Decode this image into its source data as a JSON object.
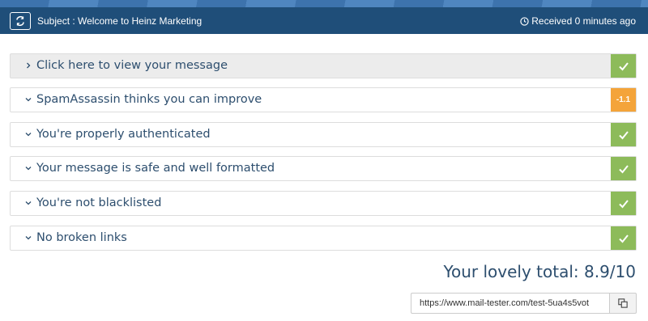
{
  "header": {
    "subject": "Subject : Welcome to Heinz Marketing",
    "received": "Received 0 minutes ago",
    "refresh_icon": "refresh-icon",
    "clock_icon": "clock-icon",
    "background_color": "#1f4e79"
  },
  "checks": [
    {
      "label": "Click here to view your message",
      "expanded": false,
      "status": "ok",
      "badge": "✓"
    },
    {
      "label": "SpamAssassin thinks you can improve",
      "expanded": true,
      "status": "warn",
      "badge": "-1.1"
    },
    {
      "label": "You're properly authenticated",
      "expanded": true,
      "status": "ok",
      "badge": "✓"
    },
    {
      "label": "Your message is safe and well formatted",
      "expanded": true,
      "status": "ok",
      "badge": "✓"
    },
    {
      "label": "You're not blacklisted",
      "expanded": true,
      "status": "ok",
      "badge": "✓"
    },
    {
      "label": "No broken links",
      "expanded": true,
      "status": "ok",
      "badge": "✓"
    }
  ],
  "colors": {
    "ok": "#8dbb5a",
    "warn": "#f4a43a",
    "text": "#2d4e6e"
  },
  "total": {
    "label": "Your lovely total: 8.9/10"
  },
  "share": {
    "url": "https://www.mail-tester.com/test-5ua4s5vot",
    "copy_icon": "copy-icon"
  }
}
